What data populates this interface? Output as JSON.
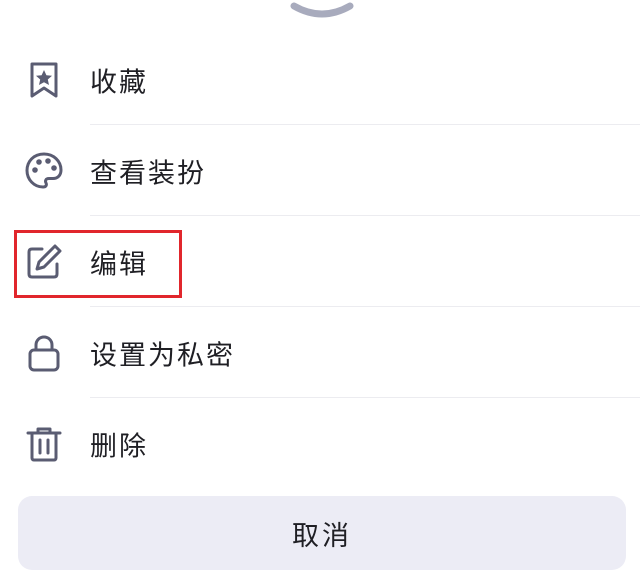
{
  "sheet": {
    "handle_icon": "chevron-down-icon"
  },
  "menu": {
    "items": [
      {
        "label": "收藏",
        "icon": "bookmark-star-icon"
      },
      {
        "label": "查看装扮",
        "icon": "palette-icon"
      },
      {
        "label": "编辑",
        "icon": "edit-icon"
      },
      {
        "label": "设置为私密",
        "icon": "lock-icon"
      },
      {
        "label": "删除",
        "icon": "trash-icon"
      }
    ]
  },
  "highlight": {
    "color": "#e1262c",
    "target": "编辑"
  },
  "cancel": {
    "label": "取消"
  },
  "colors": {
    "icon": "#5a5c72",
    "text": "#1f1f24",
    "cancel_bg": "#ececf5",
    "divider": "#ececf0"
  }
}
